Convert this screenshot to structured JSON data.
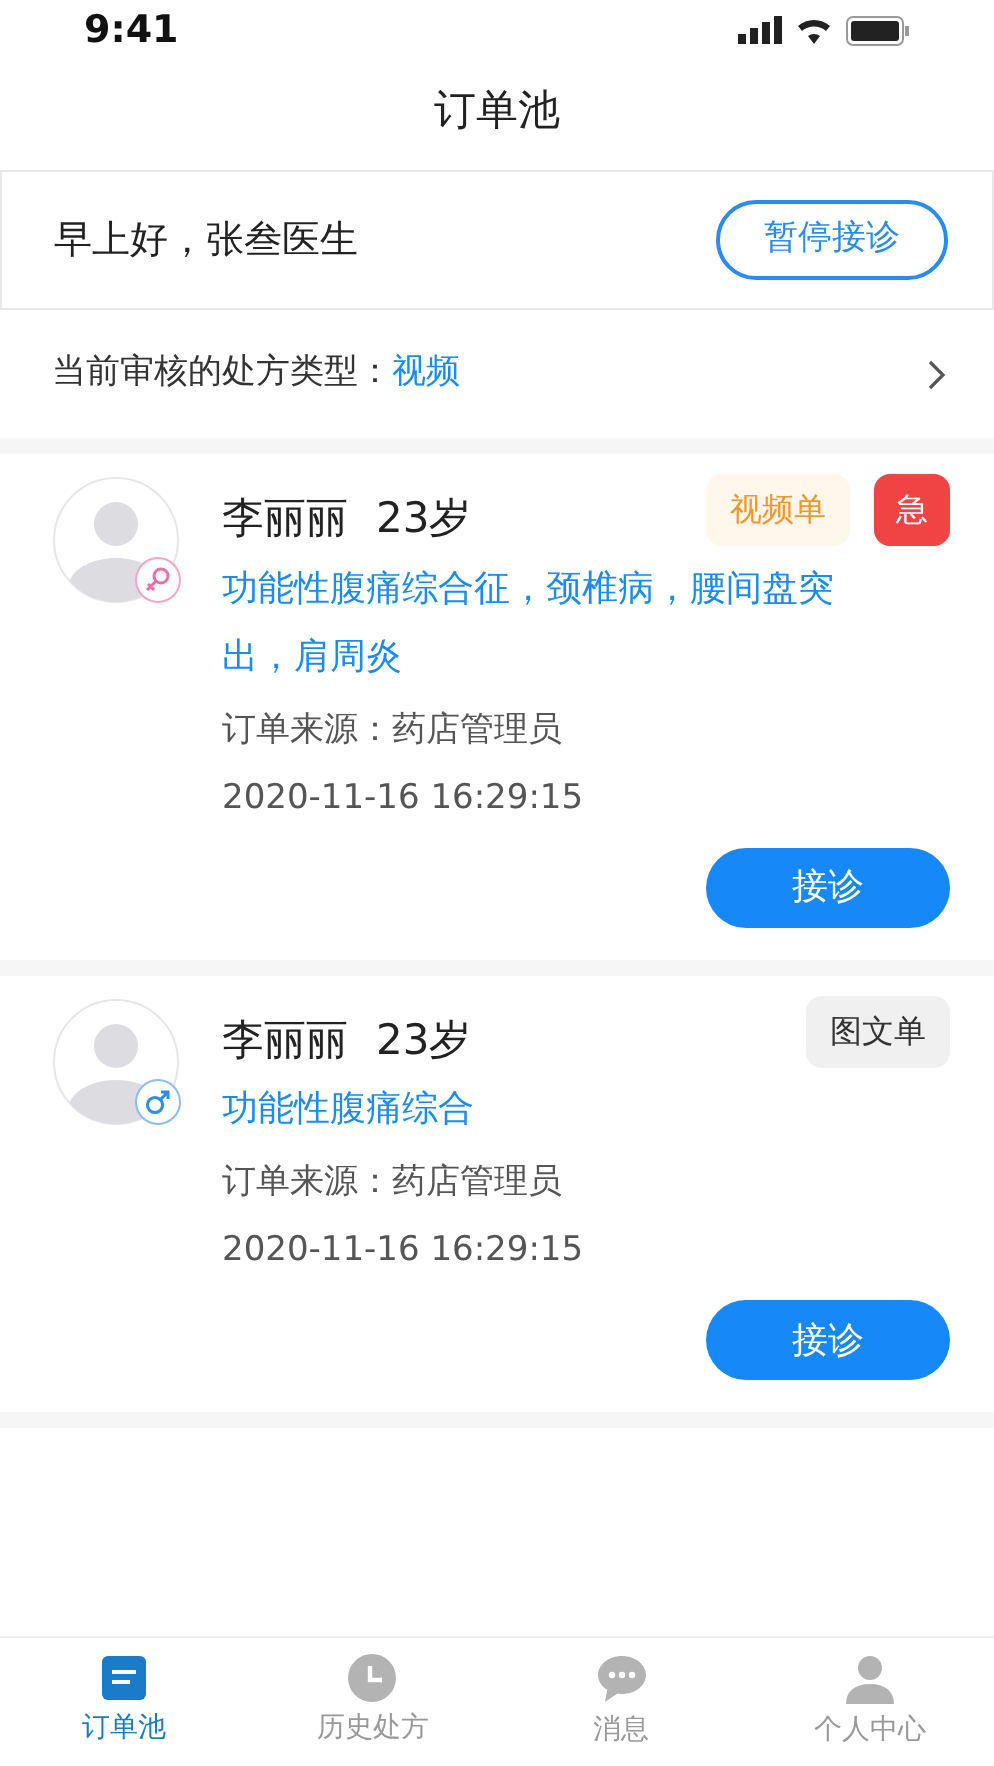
{
  "status_bar": {
    "time": "9:41"
  },
  "header": {
    "title": "订单池"
  },
  "greeting": {
    "text": "早上好，张叁医生",
    "button": "暂停接诊"
  },
  "review_type": {
    "label": "当前审核的处方类型：",
    "value": "视频"
  },
  "orders": [
    {
      "name": "李丽丽",
      "age": "23岁",
      "kind": "female",
      "tags": [
        {
          "kind": "video",
          "label": "视频单"
        },
        {
          "kind": "urgent",
          "label": "急"
        }
      ],
      "diagnosis": "功能性腹痛综合征，颈椎病，腰间盘突出，肩周炎",
      "source": "订单来源：药店管理员",
      "time": "2020-11-16 16:29:15",
      "button": "接诊"
    },
    {
      "name": "李丽丽",
      "age": "23岁",
      "kind": "male",
      "tags": [
        {
          "kind": "text",
          "label": "图文单"
        }
      ],
      "diagnosis": "功能性腹痛综合",
      "source": "订单来源：药店管理员",
      "time": "2020-11-16 16:29:15",
      "button": "接诊"
    }
  ],
  "tab_bar": [
    {
      "kind": "orders",
      "label": "订单池",
      "selected": true
    },
    {
      "kind": "history",
      "label": "历史处方",
      "selected": false
    },
    {
      "kind": "messages",
      "label": "消息",
      "selected": false
    },
    {
      "kind": "profile",
      "label": "个人中心",
      "selected": false
    }
  ]
}
